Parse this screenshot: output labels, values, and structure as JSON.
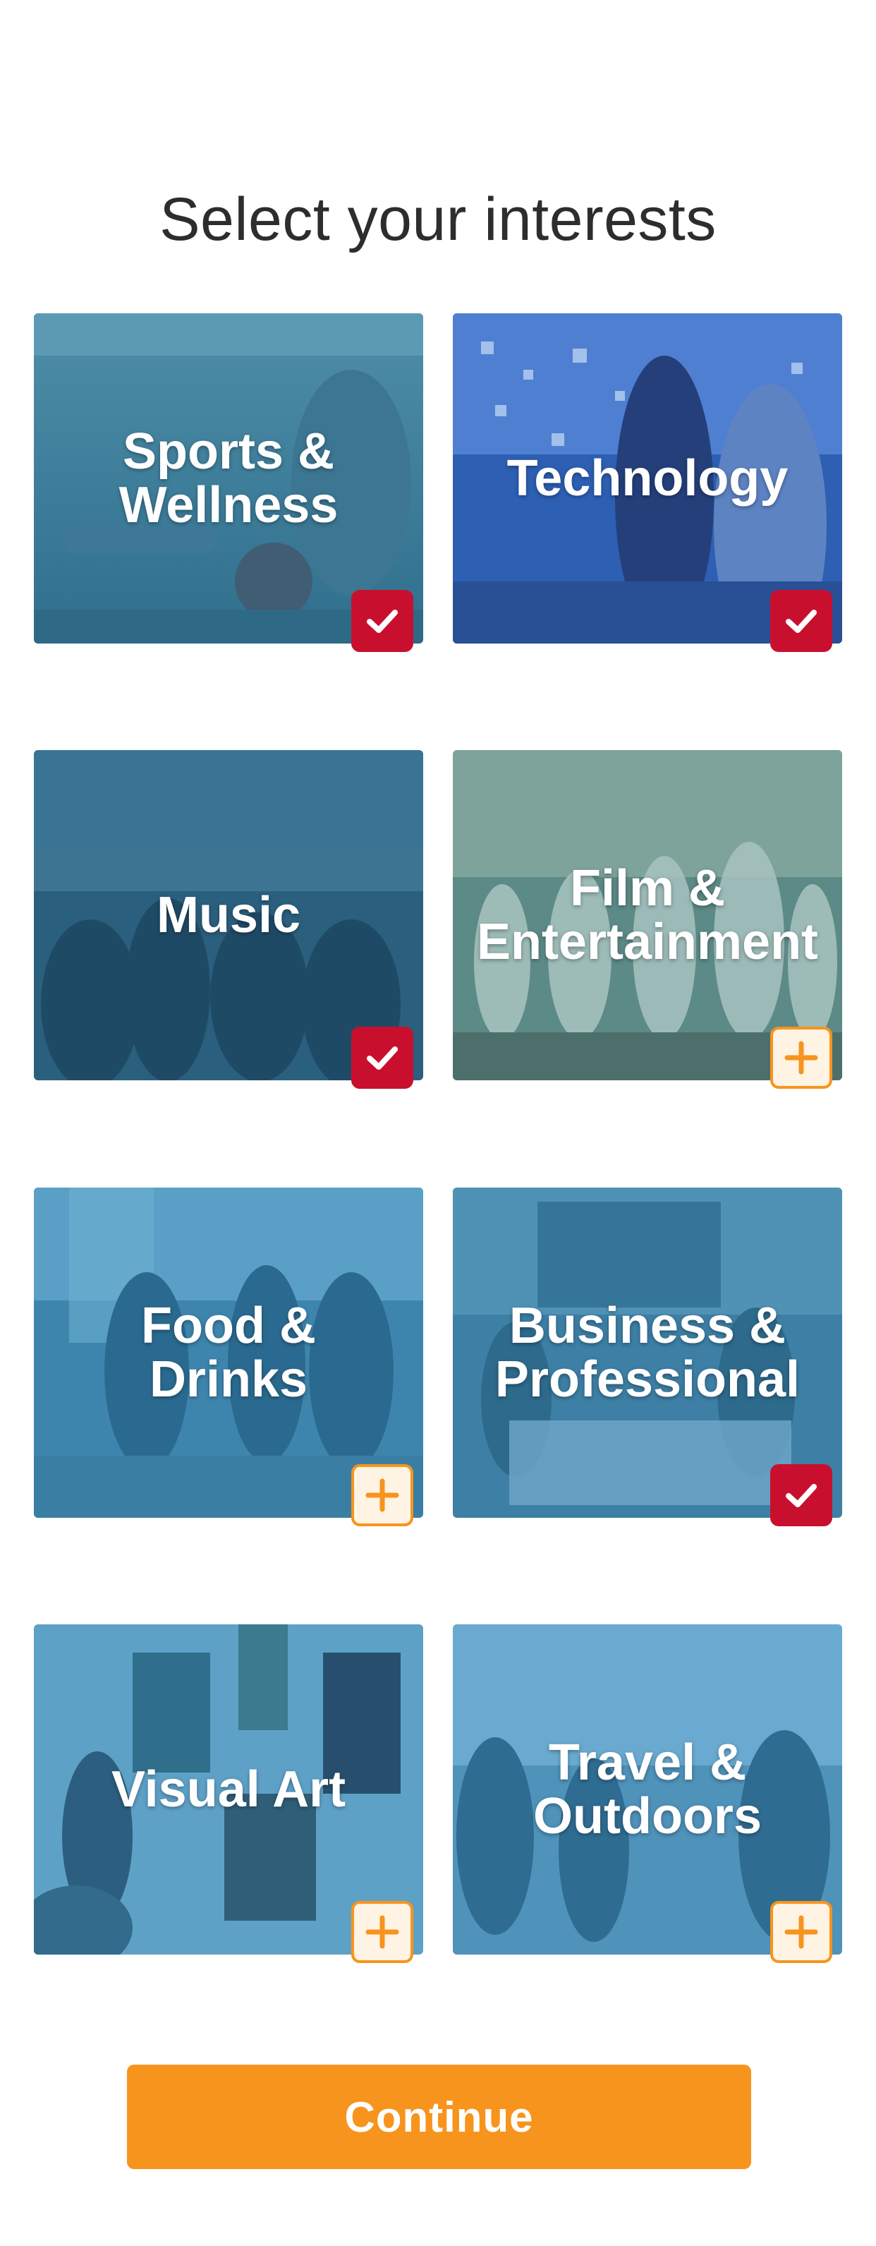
{
  "page": {
    "title": "Select your interests"
  },
  "interests": [
    {
      "label": "Sports &\nWellness",
      "selected": true,
      "image": "sports"
    },
    {
      "label": "Technology",
      "selected": true,
      "image": "technology"
    },
    {
      "label": "Music",
      "selected": true,
      "image": "music"
    },
    {
      "label": "Film &\nEntertainment",
      "selected": false,
      "image": "film"
    },
    {
      "label": "Food &\nDrinks",
      "selected": false,
      "image": "food"
    },
    {
      "label": "Business &\nProfessional",
      "selected": true,
      "image": "business"
    },
    {
      "label": "Visual Art",
      "selected": false,
      "image": "visual-art"
    },
    {
      "label": "Travel &\nOutdoors",
      "selected": false,
      "image": "travel"
    }
  ],
  "continue_label": "Continue",
  "colors": {
    "accent": "#f7941d",
    "selected": "#c8102e",
    "overlay": "#2a7fb0"
  },
  "icons": {
    "selected": "check-icon",
    "unselected": "plus-icon"
  }
}
